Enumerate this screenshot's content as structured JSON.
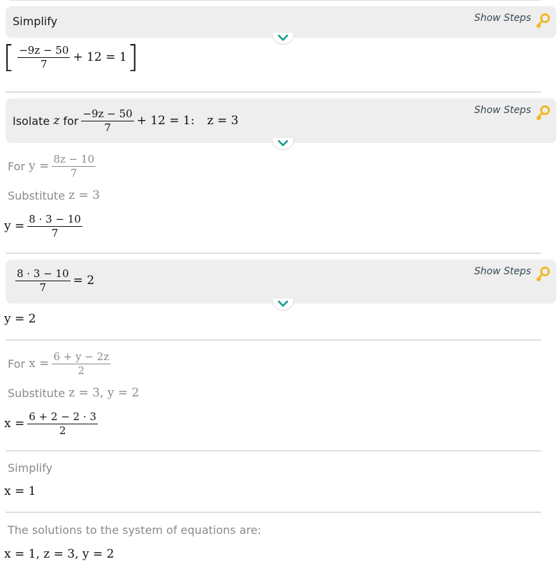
{
  "show_steps_label": "Show Steps",
  "icons": {
    "key": "key-icon",
    "expand": "chevron-down-icon"
  },
  "colors": {
    "box_bg": "#eeeeee",
    "key": "#f0b92a",
    "chevron": "#1a9a8f",
    "muted_text": "#8a8a8a"
  },
  "step1": {
    "title": "Simplify",
    "result": {
      "num": "−9z − 50",
      "den": "7",
      "rest": "+ 12 = 1"
    }
  },
  "step2": {
    "title_prefix": "Isolate",
    "var": "z",
    "title_for": "for",
    "eq": {
      "num": "−9z − 50",
      "den": "7",
      "rest": "+ 12 = 1:",
      "answer": "z = 3"
    }
  },
  "y_block": {
    "for_label": "For",
    "for_lhs": "y =",
    "for_num": "8z − 10",
    "for_den": "7",
    "substitute_label": "Substitute",
    "substitute_expr": "z = 3",
    "result_lhs": "y =",
    "result_num": "8 · 3 − 10",
    "result_den": "7"
  },
  "step3": {
    "num": "8 · 3 − 10",
    "den": "7",
    "rest": "= 2",
    "result": "y = 2"
  },
  "x_block": {
    "for_label": "For",
    "for_lhs": "x =",
    "for_num": "6 + y − 2z",
    "for_den": "2",
    "substitute_label": "Substitute",
    "substitute_expr": "z = 3, y = 2",
    "result_lhs": "x =",
    "result_num": "6 + 2 − 2 · 3",
    "result_den": "2"
  },
  "simplify_block": {
    "label": "Simplify",
    "result": "x = 1"
  },
  "solution": {
    "label": "The solutions to the system of equations are:",
    "result": "x = 1, z = 3, y = 2"
  }
}
